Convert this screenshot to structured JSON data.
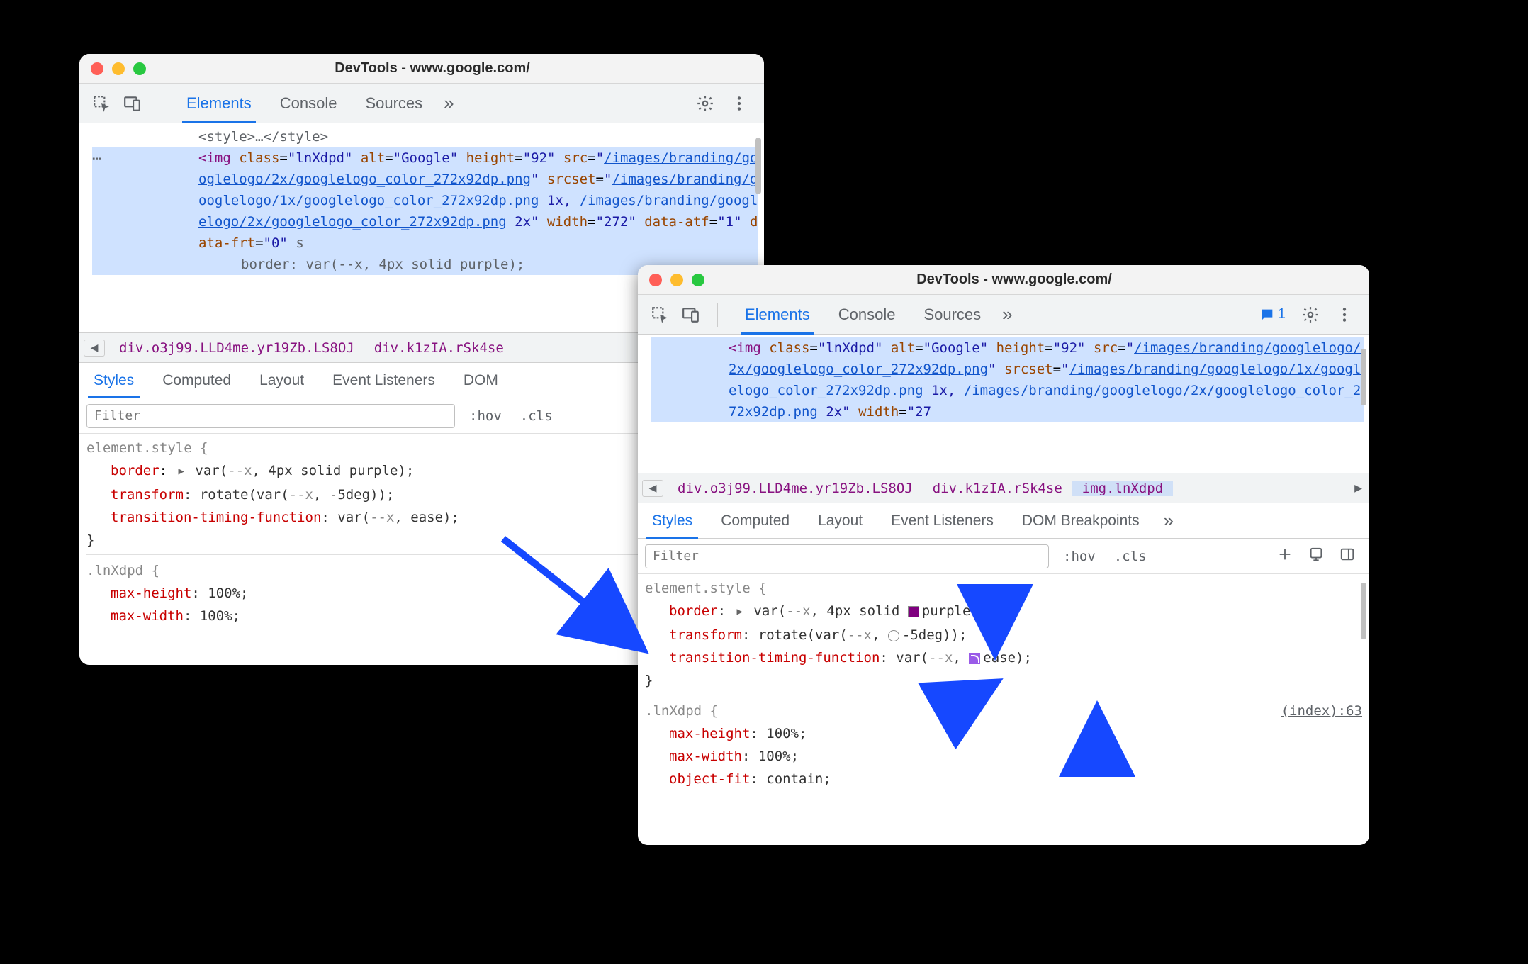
{
  "window_title": "DevTools - www.google.com/",
  "tabs": {
    "elements": "Elements",
    "console": "Console",
    "sources": "Sources"
  },
  "notif_count": "1",
  "dom_leading": "<style>…</style>",
  "img_attrs": {
    "tag_open": "<img",
    "class_k": "class",
    "class_v": "\"lnXdpd\"",
    "alt_k": "alt",
    "alt_v": "\"Google\"",
    "height_k": "height",
    "height_v": "\"92\"",
    "src_k": "src",
    "src_link": "/images/branding/googlelogo/2x/googlelogo_color_272x92dp.png",
    "srcset_k": "srcset",
    "srcset_l1": "/images/branding/googlelogo/1x/googlelogo_color_272x92dp.png",
    "srcset_1x": " 1x, ",
    "srcset_l2": "/images/branding/googlelogo/2x/googlelogo_color_272x92dp.png",
    "srcset_2x": " 2x",
    "width_k": "width",
    "width_v_left": "\"272\"",
    "width_v_right": "\"27",
    "dataatf_k": "data-atf",
    "dataatf_v": "\"1\"",
    "datafrt_k": "data-frt",
    "datafrt_v": "\"0\""
  },
  "inline_style_left": "border: var(--x, 4px solid purple);",
  "crumbs": {
    "c1": "div.o3j99.LLD4me.yr19Zb.LS8OJ",
    "c2": "div.k1zIA.rSk4se",
    "c3": "img.lnXdpd"
  },
  "subtabs": {
    "styles": "Styles",
    "computed": "Computed",
    "layout": "Layout",
    "listeners": "Event Listeners",
    "dombp": "DOM Breakpoints",
    "dom_short": "DOM"
  },
  "filter_placeholder": "Filter",
  "hov": ":hov",
  "cls": ".cls",
  "styles_left": {
    "sel1": "element.style {",
    "p1k": "border",
    "p1v_pre": "var(",
    "p1v_var": "--x",
    "p1v_rest": ", 4px solid purple);",
    "p2k": "transform",
    "p2v": ": rotate(var(",
    "p2var": "--x",
    "p2rest": ", -5deg));",
    "p3k": "transition-timing-function",
    "p3v": ": var(",
    "p3var": "--x",
    "p3rest": ", ease);",
    "close": "}",
    "sel2": ".lnXdpd {",
    "mh_k": "max-height",
    "mh_v": ": 100%;",
    "mw_k": "max-width",
    "mw_v": ": 100%;"
  },
  "styles_right": {
    "sel1": "element.style {",
    "p1k": "border",
    "p1v_pre": ": ",
    "p1var_open": "var(",
    "p1var": "--x",
    "p1mid": ", 4px solid ",
    "p1color": "purple",
    "p1end": ");",
    "p2k": "transform",
    "p2pre": ": rotate(var(",
    "p2var": "--x",
    "p2mid": ", ",
    "p2deg": "-5deg",
    "p2end": "));",
    "p3k": "transition-timing-function",
    "p3pre": ": var(",
    "p3var": "--x",
    "p3mid": ", ",
    "p3ease": "ease",
    "p3end": ");",
    "close": "}",
    "sel2": ".lnXdpd {",
    "srclink": "(index):63",
    "mh_k": "max-height",
    "mh_v": ": 100%;",
    "mw_k": "max-width",
    "mw_v": ": 100%;",
    "of_k": "object-fit",
    "of_v": ": contain;"
  }
}
